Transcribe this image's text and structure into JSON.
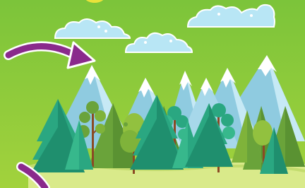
{
  "scene": {
    "description_colors": {
      "background_top": "#7cc43a",
      "background_bottom": "#a8d53f",
      "cloud_fill": "#b8e6f5",
      "cloud_edge": "#ffffff",
      "mountain_shadow": "#8fcbe0",
      "mountain_light": "#c6e9f5",
      "snow": "#ffffff",
      "tree_dark": "#1f8f6e",
      "tree_mid": "#2aa781",
      "tree_olive": "#6aa33a",
      "tree_olive_light": "#92c13f",
      "trunk": "#8b4a24",
      "ground": "#d9ea8a",
      "arrow": "#8a2a8c"
    },
    "icons": [
      "curved-arrow-icon",
      "curved-arrow-icon"
    ]
  }
}
